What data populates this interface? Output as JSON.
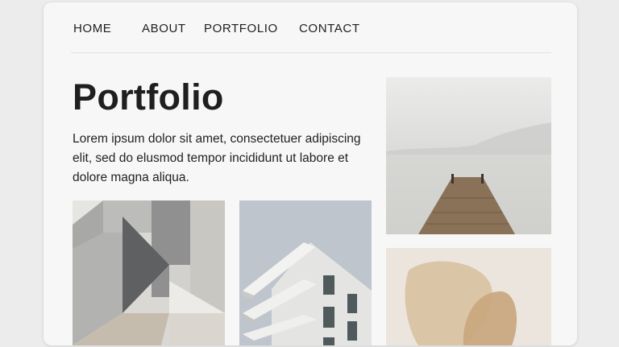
{
  "nav": {
    "items": [
      {
        "label": "HOME"
      },
      {
        "label": "ABOUT"
      },
      {
        "label": "PORTFOLIO"
      },
      {
        "label": "CONTACT"
      }
    ]
  },
  "page": {
    "title": "Portfolio",
    "intro": "Lorem ipsum dolor sit amet, consectetuer adipiscing elit, sed do elusmod tempor incididunt ut labore et dolore magna aliqua."
  },
  "gallery": {
    "items": [
      {
        "subject": "geometric-abstract"
      },
      {
        "subject": "modern-building"
      },
      {
        "subject": "foggy-lake-pier"
      },
      {
        "subject": "overlapping-shapes"
      }
    ]
  },
  "colors": {
    "background": "#ececec",
    "card": "#f7f7f7",
    "text": "#1f1f1f",
    "divider": "#e2e2e2"
  }
}
